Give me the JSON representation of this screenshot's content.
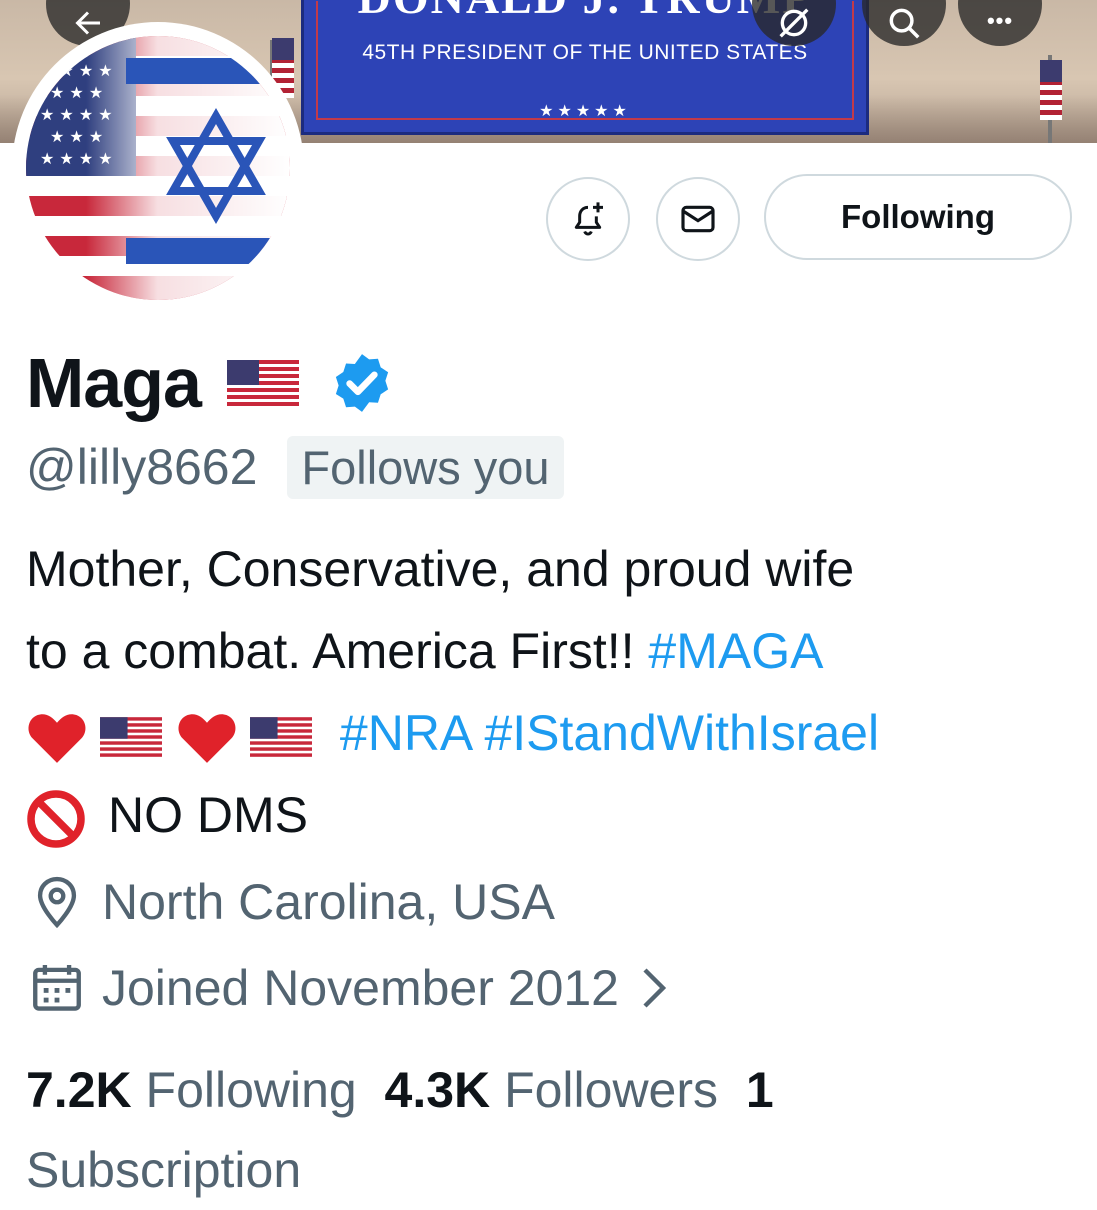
{
  "banner": {
    "sign_title": "DONALD J. TRUMP",
    "sign_subtitle": "45TH PRESIDENT OF THE UNITED STATES",
    "sign_stars": "★★★★★"
  },
  "nav": {
    "back_icon": "arrow-left-icon",
    "grok_icon": "grok-icon",
    "search_icon": "search-icon",
    "more_label": "•••"
  },
  "actions": {
    "notify_icon": "bell-plus-icon",
    "message_icon": "envelope-icon",
    "following_label": "Following"
  },
  "profile": {
    "display_name": "Maga",
    "handle": "@lilly8662",
    "follows_you": "Follows you",
    "bio_line1": "Mother, Conservative, and proud wife",
    "bio_line2_text": "to a combat. America First!! ",
    "bio_hashtag_maga": "#MAGA",
    "bio_hashtag_nra": "#NRA",
    "bio_hashtag_israel": "#IStandWithIsrael",
    "bio_no_dms": "NO DMS",
    "location": "North Carolina, USA",
    "joined": "Joined November 2012"
  },
  "stats": {
    "following_count": "7.2K",
    "following_label": "Following",
    "followers_count": "4.3K",
    "followers_label": "Followers",
    "subscription_count": "1",
    "subscription_label": "Subscription"
  },
  "colors": {
    "link": "#1d9bf0",
    "secondary_text": "#536471",
    "primary_text": "#0f1419",
    "verified": "#1d9bf0"
  }
}
